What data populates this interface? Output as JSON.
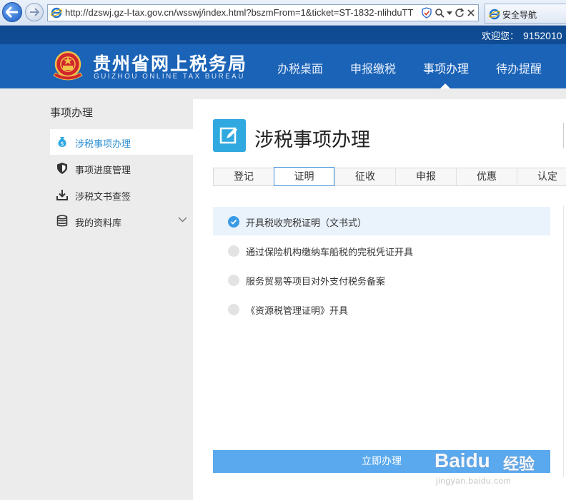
{
  "browser": {
    "url": "http://dzswj.gz-l-tax.gov.cn/wsswj/index.html?bszmFrom=1&ticket=ST-1832-nlihduTT",
    "tab_title": "安全导航"
  },
  "header": {
    "welcome_label": "欢迎您：",
    "user_id": "9152010",
    "logo_title": "贵州省网上税务局",
    "logo_subtitle": "GUIZHOU ONLINE TAX BUREAU",
    "nav": [
      {
        "label": "办税桌面"
      },
      {
        "label": "申报缴税"
      },
      {
        "label": "事项办理"
      },
      {
        "label": "待办提醒"
      }
    ],
    "active_nav": "事项办理"
  },
  "sidebar": {
    "title": "事项办理",
    "items": [
      {
        "label": "涉税事项办理"
      },
      {
        "label": "事项进度管理"
      },
      {
        "label": "涉税文书查签"
      },
      {
        "label": "我的资料库"
      }
    ],
    "active_item": "涉税事项办理"
  },
  "main": {
    "title": "涉税事项办理",
    "tabs": [
      {
        "label": "登记"
      },
      {
        "label": "证明"
      },
      {
        "label": "征收"
      },
      {
        "label": "申报"
      },
      {
        "label": "优惠"
      },
      {
        "label": "认定"
      }
    ],
    "active_tab": "证明",
    "options": [
      {
        "label": "开具税收完税证明（文书式）",
        "selected": true
      },
      {
        "label": "通过保险机构缴纳车船税的完税凭证开具",
        "selected": false
      },
      {
        "label": "服务贸易等项目对外支付税务备案",
        "selected": false
      },
      {
        "label": "《资源税管理证明》开具",
        "selected": false
      }
    ],
    "submit_label": "立即办理"
  },
  "watermark": {
    "brand": "Baidu",
    "brand_cn": "经验",
    "url": "jingyan.baidu.com"
  },
  "colors": {
    "header_dark": "#0e4b93",
    "header": "#1b63b7",
    "accent": "#2fa9e0",
    "active_blue": "#3a9ae6",
    "button": "#5aa9ee",
    "selected_row": "#eaf2fb"
  }
}
